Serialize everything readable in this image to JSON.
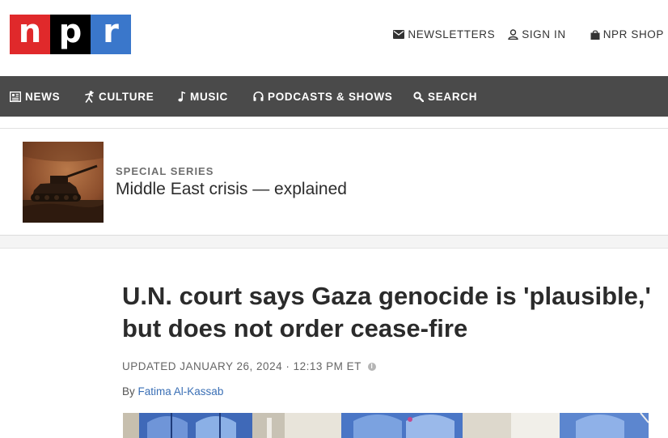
{
  "logo": {
    "letters": [
      "n",
      "p",
      "r"
    ],
    "alt": "npr"
  },
  "utility": {
    "newsletters": "NEWSLETTERS",
    "sign_in": "SIGN IN",
    "shop": "NPR SHOP"
  },
  "nav": {
    "items": [
      {
        "label": "NEWS",
        "icon": "news-icon"
      },
      {
        "label": "CULTURE",
        "icon": "culture-icon"
      },
      {
        "label": "MUSIC",
        "icon": "music-note-icon"
      },
      {
        "label": "PODCASTS & SHOWS",
        "icon": "headphones-icon"
      },
      {
        "label": "SEARCH",
        "icon": "search-icon"
      }
    ]
  },
  "series": {
    "kicker": "SPECIAL SERIES",
    "title": "Middle East crisis — explained"
  },
  "article": {
    "headline": "U.N. court says Gaza genocide is 'plausible,' but does not order cease-fire",
    "dateline": "UPDATED JANUARY 26, 2024 · 12:13 PM ET",
    "byline_prefix": "By",
    "author": "Fatima Al-Kassab"
  },
  "colors": {
    "npr_red": "#e0292b",
    "npr_black": "#000000",
    "npr_blue": "#3a77cb",
    "nav_bg": "#4a4a4a",
    "link": "#3a6fb5"
  }
}
